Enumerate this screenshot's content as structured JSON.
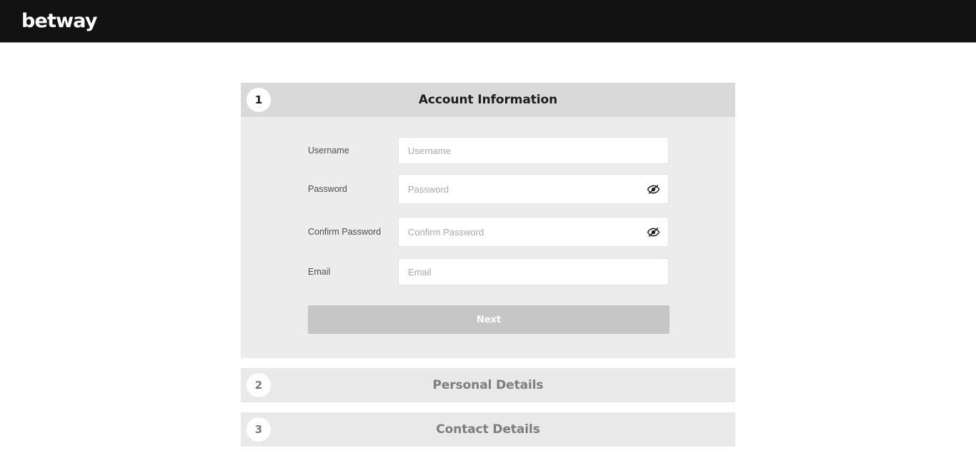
{
  "header": {
    "brand": "betway",
    "background_color": "#121212"
  },
  "wizard": {
    "steps": [
      {
        "number": "1",
        "title": "Account Information",
        "state": "active",
        "header_color": "#d9d9d9",
        "body_color": "#ececec",
        "fields": [
          {
            "label": "Username",
            "placeholder": "Username",
            "value": "",
            "type": "text",
            "has_toggle": false
          },
          {
            "label": "Password",
            "placeholder": "Password",
            "value": "",
            "type": "password",
            "has_toggle": true,
            "toggle_icon": "eye-off-icon"
          },
          {
            "label": "Confirm Password",
            "placeholder": "Confirm Password",
            "value": "",
            "type": "password",
            "has_toggle": true,
            "toggle_icon": "eye-off-icon"
          },
          {
            "label": "Email",
            "placeholder": "Email",
            "value": "",
            "type": "email",
            "has_toggle": false
          }
        ],
        "submit": {
          "label": "Next",
          "enabled": false,
          "color": "#c6c6c6"
        }
      },
      {
        "number": "2",
        "title": "Personal Details",
        "state": "inactive",
        "header_color": "#e9e9e9"
      },
      {
        "number": "3",
        "title": "Contact Details",
        "state": "inactive",
        "header_color": "#e9e9e9"
      }
    ]
  }
}
